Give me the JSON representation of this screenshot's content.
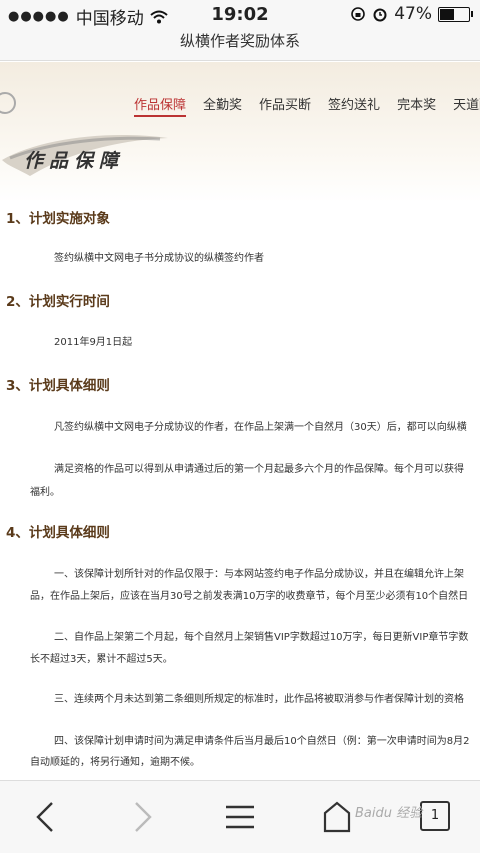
{
  "status": {
    "carrier": "中国移动",
    "time": "19:02",
    "battery": "47%"
  },
  "page_title": "纵横作者奖励体系",
  "nav": [
    "作品保障",
    "全勤奖",
    "作品买断",
    "签约送礼",
    "完本奖",
    "天道酬勤"
  ],
  "banner": "作品保障",
  "sections": [
    {
      "heading": "1、计划实施对象",
      "lines": [
        "签约纵横中文网电子书分成协议的纵横签约作者"
      ]
    },
    {
      "heading": "2、计划实行时间",
      "lines": [
        "2011年9月1日起"
      ]
    },
    {
      "heading": "3、计划具体细则",
      "lines": [
        "凡签约纵横中文网电子分成协议的作者，在作品上架满一个自然月（30天）后，都可以向纵横",
        "满足资格的作品可以得到从申请通过后的第一个月起最多六个月的作品保障。每个月可以获得",
        "福利。"
      ]
    },
    {
      "heading": "4、计划具体细则",
      "lines": [
        "一、该保障计划所针对的作品仅限于：与本网站签约电子作品分成协议，并且在编辑允许上架",
        "品，在作品上架后，应该在当月30号之前发表满10万字的收费章节，每个月至少必须有10个自然日",
        "二、自作品上架第二个月起，每个自然月上架销售VIP字数超过10万字，每日更新VIP章节字数",
        "长不超过3天，累计不超过5天。",
        "三、连续两个月未达到第二条细则所规定的标准时，此作品将被取消参与作者保障计划的资格",
        "四、该保障计划申请时间为满足申请条件后当月最后10个自然日（例：第一次申请时间为8月2",
        "自动顺延的，将另行通知，逾期不候。"
      ]
    }
  ],
  "toolbar": {
    "tabs_count": "1"
  },
  "watermark": "Baidu 经验"
}
